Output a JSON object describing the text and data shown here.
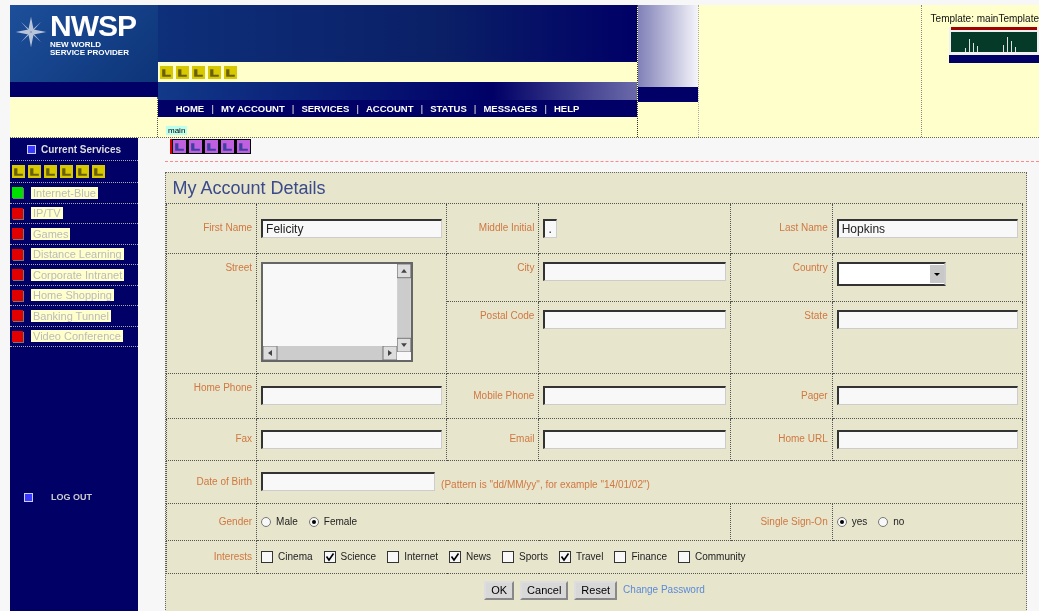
{
  "header": {
    "logo_name": "NWSP",
    "logo_tagline": [
      "NEW WORLD",
      "SERVICE PROVIDER"
    ],
    "nav": {
      "separator": "|",
      "items": [
        "HOME",
        "MY ACCOUNT",
        "SERVICES",
        "ACCOUNT",
        "STATUS",
        "MESSAGES",
        "HELP"
      ]
    },
    "frame_label": "main",
    "template_label": "Template: mainTemplate"
  },
  "sidebar": {
    "title": "Current Services",
    "services": [
      {
        "label": "Internet-Blue",
        "color": "#00e000"
      },
      {
        "label": "IP/TV",
        "color": "#e00000"
      },
      {
        "label": "Games",
        "color": "#e00000"
      },
      {
        "label": "Distance Learning",
        "color": "#e00000"
      },
      {
        "label": "Corporate Intranet",
        "color": "#e00000"
      },
      {
        "label": "Home Shopping",
        "color": "#e00000"
      },
      {
        "label": "Banking Tunnel",
        "color": "#e00000"
      },
      {
        "label": "Video Conference",
        "color": "#e00000"
      }
    ],
    "logout": "LOG OUT"
  },
  "form": {
    "title": "My Account Details",
    "first_name": {
      "label": "First Name",
      "value": "Felicity"
    },
    "middle_initial": {
      "label": "Middle Initial",
      "value": "."
    },
    "last_name": {
      "label": "Last Name",
      "value": "Hopkins"
    },
    "street": {
      "label": "Street"
    },
    "city": {
      "label": "City"
    },
    "country": {
      "label": "Country"
    },
    "postal_code": {
      "label": "Postal Code"
    },
    "state": {
      "label": "State"
    },
    "home_phone": {
      "label": "Home Phone"
    },
    "mobile_phone": {
      "label": "Mobile Phone"
    },
    "pager": {
      "label": "Pager"
    },
    "fax": {
      "label": "Fax"
    },
    "email": {
      "label": "Email"
    },
    "home_url": {
      "label": "Home URL"
    },
    "date_of_birth": {
      "label": "Date of Birth",
      "hint": "(Pattern is \"dd/MM/yy\", for example \"14/01/02\")"
    },
    "gender": {
      "label": "Gender",
      "options": [
        {
          "label": "Male",
          "selected": false
        },
        {
          "label": "Female",
          "selected": true
        }
      ]
    },
    "single_sign_on": {
      "label": "Single Sign-On",
      "options": [
        {
          "label": "yes",
          "selected": true
        },
        {
          "label": "no",
          "selected": false
        }
      ]
    },
    "interests": {
      "label": "Interests",
      "options": [
        {
          "label": "Cinema",
          "checked": false
        },
        {
          "label": "Science",
          "checked": true
        },
        {
          "label": "Internet",
          "checked": false
        },
        {
          "label": "News",
          "checked": true
        },
        {
          "label": "Sports",
          "checked": false
        },
        {
          "label": "Travel",
          "checked": true
        },
        {
          "label": "Finance",
          "checked": false
        },
        {
          "label": "Community",
          "checked": false
        }
      ]
    },
    "buttons": [
      "OK",
      "Cancel",
      "Reset"
    ],
    "link": "Change Password"
  }
}
